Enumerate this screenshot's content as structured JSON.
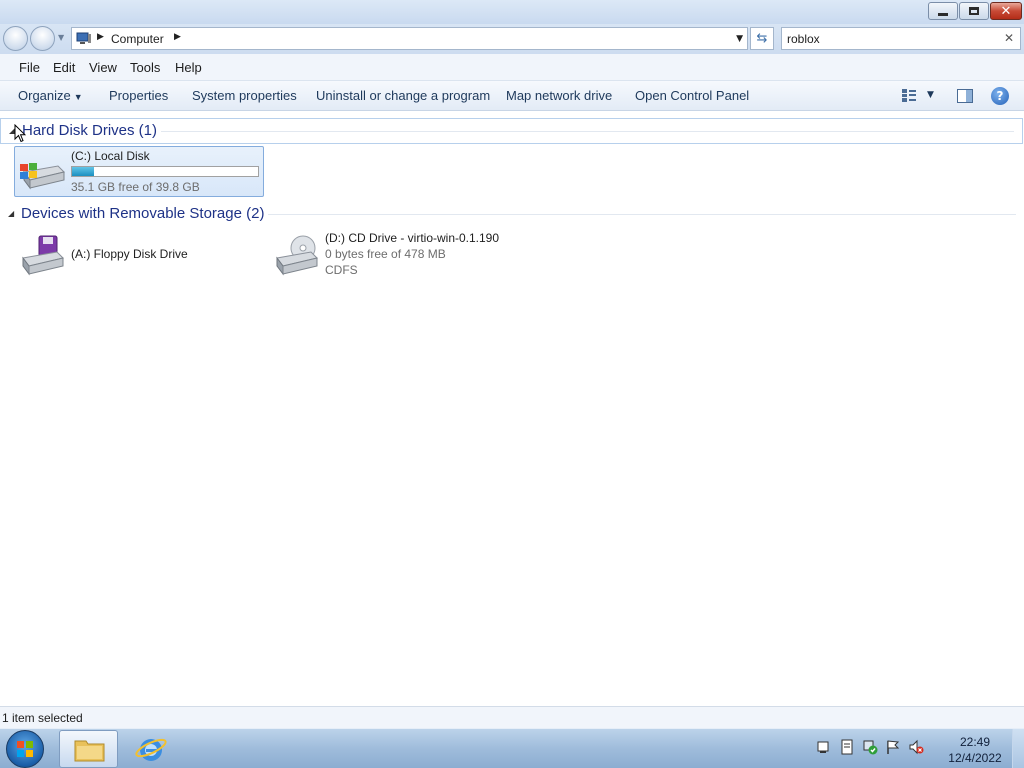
{
  "window": {
    "caption_buttons": [
      "minimize",
      "maximize",
      "close"
    ]
  },
  "address": {
    "location": "Computer",
    "search_value": "roblox"
  },
  "menu": {
    "items": [
      "File",
      "Edit",
      "View",
      "Tools",
      "Help"
    ]
  },
  "commands": {
    "organize": "Organize",
    "properties": "Properties",
    "system_properties": "System properties",
    "uninstall": "Uninstall or change a program",
    "map_drive": "Map network drive",
    "control_panel": "Open Control Panel"
  },
  "groups": [
    {
      "label": "Hard Disk Drives (1)",
      "drives": [
        {
          "name": "(C:) Local Disk",
          "space": "35.1 GB free of 39.8 GB",
          "used_fraction": 0.118,
          "selected": true
        }
      ]
    },
    {
      "label": "Devices with Removable Storage (2)",
      "drives": [
        {
          "name": "(A:) Floppy Disk Drive"
        },
        {
          "name": "(D:) CD Drive - virtio-win-0.1.190",
          "space": "0 bytes free of 478 MB",
          "fs": "CDFS"
        }
      ]
    }
  ],
  "status": {
    "text": "1 item selected"
  },
  "taskbar": {
    "time": "22:49",
    "date": "12/4/2022"
  },
  "colors": {
    "group_header": "#1e3287",
    "capacity_fill": "#1b8fc0",
    "selection_border": "#84acdd"
  }
}
